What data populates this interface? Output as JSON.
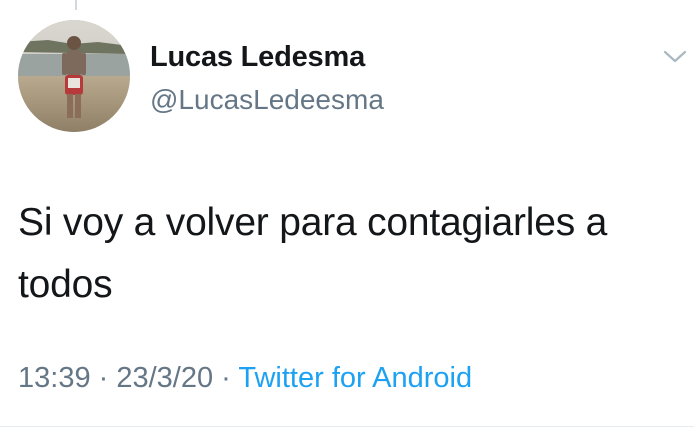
{
  "tweet": {
    "author": {
      "display_name": "Lucas Ledesma",
      "handle": "@LucasLedeesma"
    },
    "text": "Si voy a volver para contagiarles a todos",
    "meta": {
      "time": "13:39",
      "separator": " · ",
      "date": "23/3/20",
      "source": "Twitter for Android"
    }
  },
  "icons": {
    "menu": "chevron-down-icon"
  },
  "colors": {
    "text": "#14171a",
    "secondary": "#657786",
    "link": "#1da1f2"
  }
}
